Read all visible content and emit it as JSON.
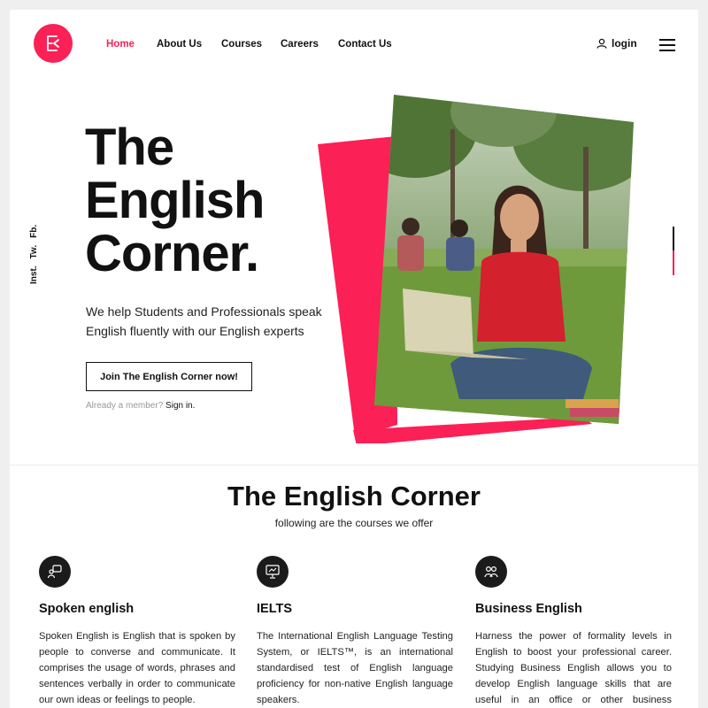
{
  "nav": {
    "items": [
      {
        "label": "Home",
        "active": true
      },
      {
        "label": "About Us",
        "active": false
      },
      {
        "label": "Courses",
        "active": false
      },
      {
        "label": "Careers",
        "active": false
      },
      {
        "label": "Contact Us",
        "active": false
      }
    ],
    "login_label": "login",
    "menu_icon": "hamburger-icon",
    "user_icon": "user-icon"
  },
  "social": [
    "Fb.",
    "Tw.",
    "Inst."
  ],
  "hero": {
    "title_lines": [
      "The",
      "English",
      "Corner."
    ],
    "subtitle": "We help Students and Professionals speak English fluently with our English experts",
    "cta_label": "Join The English Corner now!",
    "member_text": "Already a member?",
    "signin_label": "Sign in."
  },
  "section": {
    "title": "The English Corner",
    "subtitle": "following are the courses we offer"
  },
  "courses": [
    {
      "icon": "speech-icon",
      "title": "Spoken english",
      "text": "Spoken English is English that is spoken by people to converse and communicate. It comprises the usage of words, phrases and sentences verbally in order to communicate our own ideas or feelings to people."
    },
    {
      "icon": "presentation-icon",
      "title": "IELTS",
      "text": "The International English Language Testing System, or IELTS™, is an international standardised test of English language proficiency for non-native English language speakers."
    },
    {
      "icon": "business-icon",
      "title": "Business English",
      "text": "Harness the power of formality levels in English to boost your professional career. Studying Business English allows you to develop English language skills that are useful in an office or other business environments."
    }
  ],
  "colors": {
    "accent": "#fb2056",
    "text": "#111111",
    "icon_bg": "#1b1b1b"
  }
}
